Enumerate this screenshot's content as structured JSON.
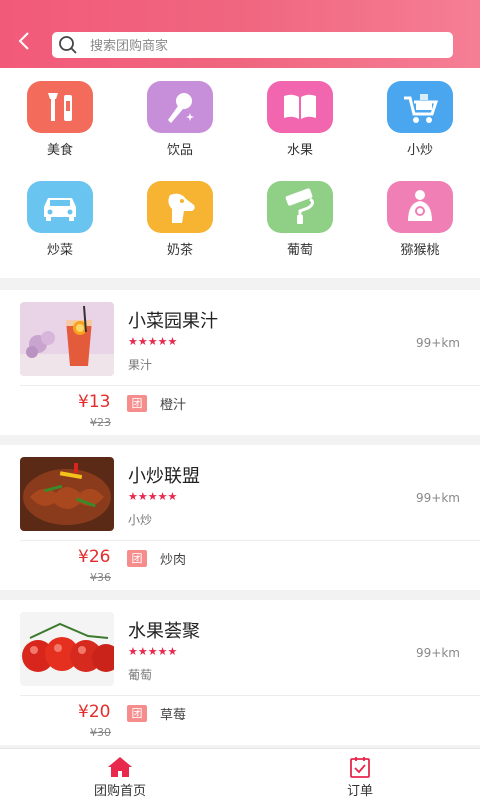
{
  "search": {
    "placeholder": "搜索团购商家"
  },
  "categories": [
    {
      "label": "美食",
      "icon": "food-icon",
      "color": "#f26b5b"
    },
    {
      "label": "饮品",
      "icon": "microphone-icon",
      "color": "#c78fd9"
    },
    {
      "label": "水果",
      "icon": "book-icon",
      "color": "#f266b0"
    },
    {
      "label": "小炒",
      "icon": "cart-icon",
      "color": "#4aa6ee"
    },
    {
      "label": "炒菜",
      "icon": "car-icon",
      "color": "#6ac4f0"
    },
    {
      "label": "奶茶",
      "icon": "dog-icon",
      "color": "#f6b432"
    },
    {
      "label": "葡萄",
      "icon": "paint-roller-icon",
      "color": "#8fcf86"
    },
    {
      "label": "猕猴桃",
      "icon": "mother-baby-icon",
      "color": "#f07fb5"
    }
  ],
  "shops": [
    {
      "name": "小菜园果汁",
      "stars": "★★★★★",
      "category": "果汁",
      "distance": "99+km",
      "price": "¥13",
      "old_price": "¥23",
      "tag": "团",
      "item": "橙汁"
    },
    {
      "name": "小炒联盟",
      "stars": "★★★★★",
      "category": "小炒",
      "distance": "99+km",
      "price": "¥26",
      "old_price": "¥36",
      "tag": "团",
      "item": "炒肉"
    },
    {
      "name": "水果荟聚",
      "stars": "★★★★★",
      "category": "葡萄",
      "distance": "99+km",
      "price": "¥20",
      "old_price": "¥30",
      "tag": "团",
      "item": "草莓"
    }
  ],
  "tabs": [
    {
      "label": "团购首页",
      "icon": "home-icon",
      "active": true
    },
    {
      "label": "订单",
      "icon": "order-icon",
      "active": false
    }
  ],
  "colors": {
    "header": "#f25a7a",
    "price": "#e32d2d",
    "stars": "#e8284d",
    "active_tab": "#e8284d"
  }
}
